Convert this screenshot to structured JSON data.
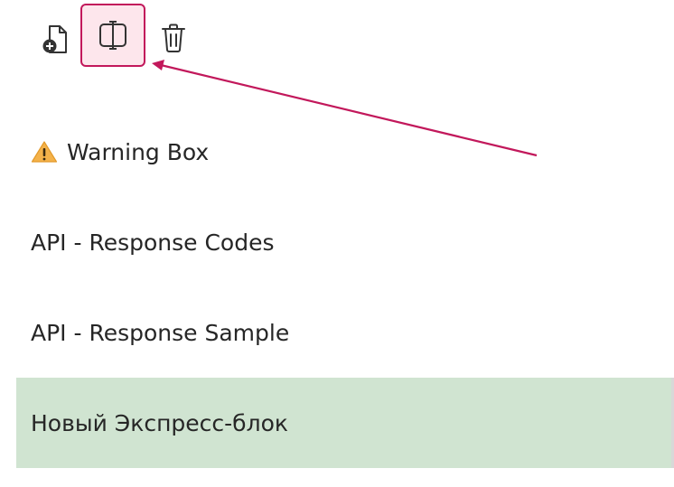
{
  "toolbar": {
    "buttons": [
      {
        "name": "new-page",
        "icon": "file-plus-icon"
      },
      {
        "name": "split",
        "icon": "split-view-icon",
        "highlighted": true,
        "highlight_color": "#c2185b"
      },
      {
        "name": "delete",
        "icon": "trash-icon"
      }
    ]
  },
  "annotation": {
    "type": "arrow",
    "color": "#c2185b"
  },
  "list": {
    "items": [
      {
        "label": "Warning Box",
        "icon": "warning-icon"
      },
      {
        "label": "API - Response Codes"
      },
      {
        "label": "API - Response Sample"
      },
      {
        "label": "Новый Экспресс-блок",
        "selected": true
      }
    ],
    "selected_color": "#d0e4d1"
  }
}
